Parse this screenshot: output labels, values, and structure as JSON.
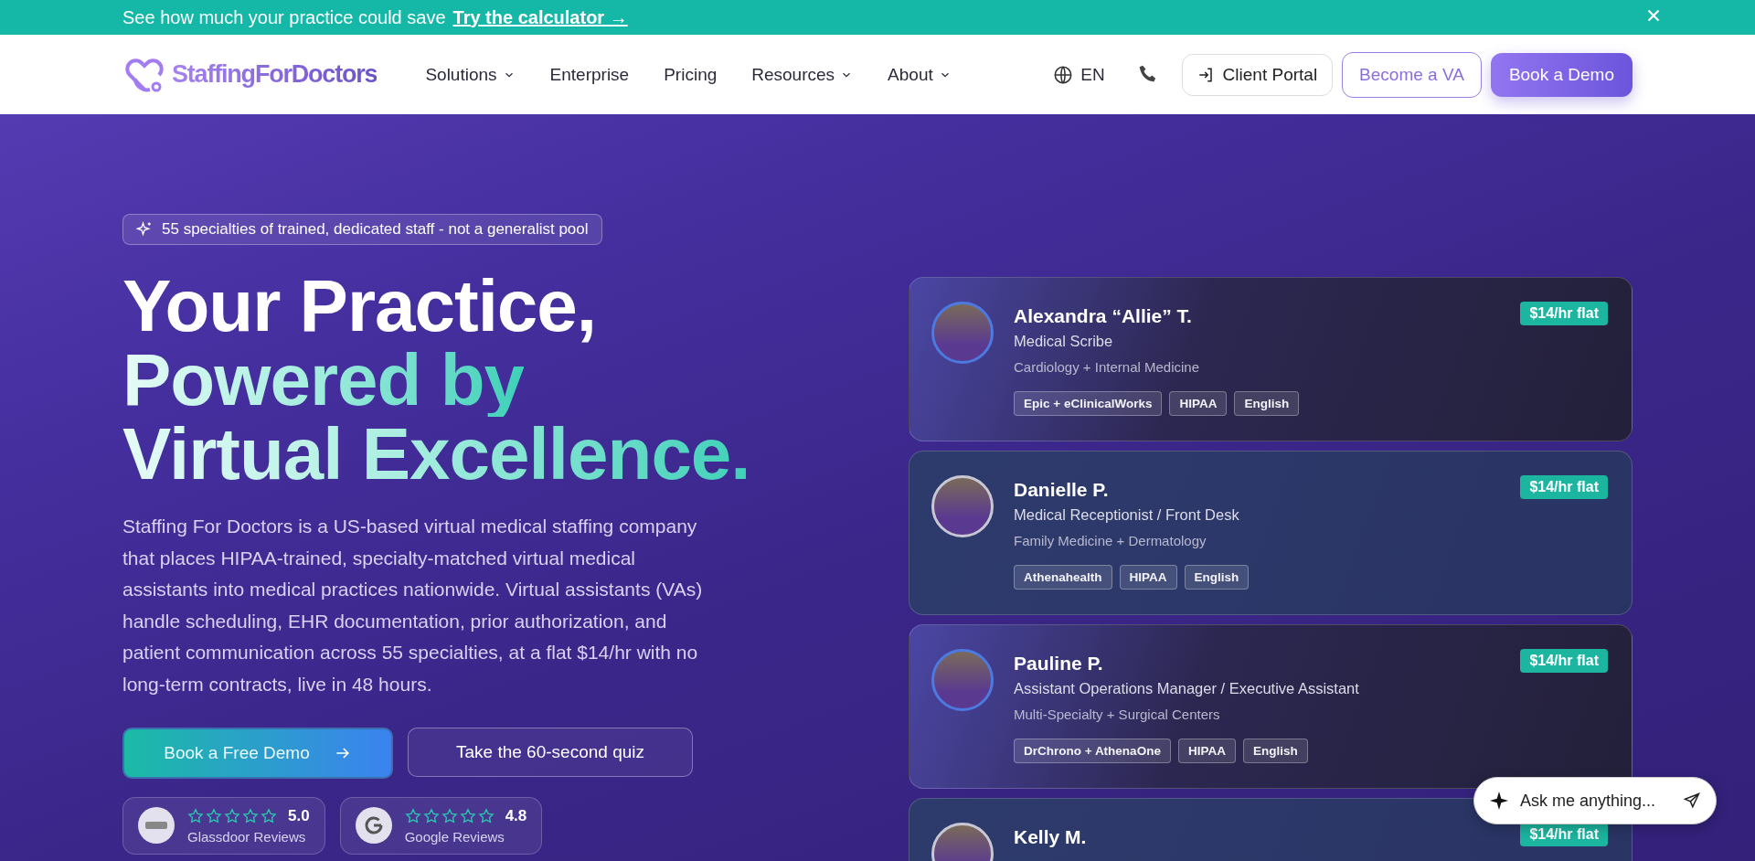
{
  "promo_bar": {
    "text": "See how much your practice could save",
    "link": "Try the calculator →"
  },
  "nav": {
    "logo": "StaffingForDoctors",
    "items": [
      {
        "label": "Solutions",
        "dropdown": true
      },
      {
        "label": "Enterprise",
        "dropdown": false
      },
      {
        "label": "Pricing",
        "dropdown": false
      },
      {
        "label": "Resources",
        "dropdown": true
      },
      {
        "label": "About",
        "dropdown": true
      }
    ],
    "language": "EN",
    "client_portal": "Client Portal",
    "become_va": "Become a VA",
    "book_demo": "Book a Demo"
  },
  "hero": {
    "badge": "55 specialties of trained, dedicated staff - not a generalist pool",
    "heading": [
      {
        "text": "Your Practice,",
        "kind": "plain"
      },
      {
        "text": "Powered by",
        "kind": "gradient"
      },
      {
        "text": "Virtual Excellence.",
        "kind": "gradient"
      }
    ],
    "description": "Staffing For Doctors is a US-based virtual medical staffing company that places HIPAA-trained, specialty-matched virtual medical assistants into medical practices nationwide. Virtual assistants (VAs) handle scheduling, EHR documentation, prior authorization, and patient communication across 55 specialties, at a flat $14/hr with no long-term contracts, live in 48 hours.",
    "primary_button": "Book a Free Demo",
    "secondary_button": "Take the 60-second quiz",
    "ratings": [
      {
        "kind": "glassdoor",
        "score": "5.0",
        "source": "Glassdoor Reviews"
      },
      {
        "kind": "google",
        "score": "4.8",
        "source": "Google Reviews"
      }
    ]
  },
  "assistants": [
    {
      "name": "Alexandra “Allie” T.",
      "role": "Medical Scribe",
      "specialty": "Cardiology + Internal Medicine",
      "rate": "$14/hr flat",
      "tags": [
        "Epic + eClinicalWorks",
        "HIPAA",
        "English"
      ],
      "selected": true
    },
    {
      "name": "Danielle P.",
      "role": "Medical Receptionist / Front Desk",
      "specialty": "Family Medicine + Dermatology",
      "rate": "$14/hr flat",
      "tags": [
        "Athenahealth",
        "HIPAA",
        "English"
      ],
      "selected": false
    },
    {
      "name": "Pauline P.",
      "role": "Assistant Operations Manager / Executive Assistant",
      "specialty": "Multi-Specialty + Surgical Centers",
      "rate": "$14/hr flat",
      "tags": [
        "DrChrono + AthenaOne",
        "HIPAA",
        "English"
      ],
      "selected": true
    },
    {
      "name": "Kelly M.",
      "rate": "$14/hr flat",
      "selected": false
    }
  ],
  "chat": {
    "placeholder": "Ask me anything..."
  }
}
